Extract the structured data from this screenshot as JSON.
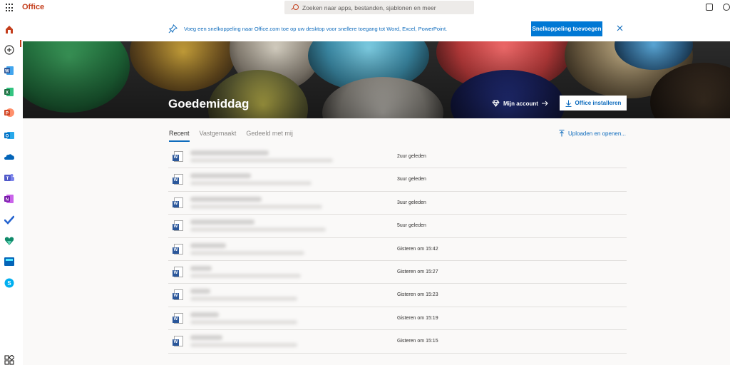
{
  "app": {
    "brand": "Office"
  },
  "search": {
    "placeholder": "Zoeken naar apps, bestanden, sjablonen en meer"
  },
  "banner": {
    "text": "Voeg een snelkoppeling naar Office.com toe op uw desktop voor snellere toegang tot Word, Excel, PowerPoint.",
    "button_label": "Snelkoppeling toevoegen"
  },
  "hero": {
    "greeting": "Goedemiddag",
    "account_label": "Mijn account",
    "install_label": "Office installeren"
  },
  "tabs": [
    {
      "label": "Recent",
      "active": true
    },
    {
      "label": "Vastgemaakt",
      "active": false
    },
    {
      "label": "Gedeeld met mij",
      "active": false
    }
  ],
  "upload_label": "Uploaden en openen...",
  "rail": {
    "icons": [
      "home-icon",
      "create-icon",
      "word-icon",
      "excel-icon",
      "powerpoint-icon",
      "outlook-icon",
      "onedrive-icon",
      "teams-icon",
      "onenote-icon",
      "todo-icon",
      "family-safety-icon",
      "sway-icon",
      "skype-icon",
      "all-apps-icon"
    ],
    "colors": {
      "home": "#c43e1c",
      "word": "#2b579a",
      "excel": "#217346",
      "powerpoint": "#d24726",
      "outlook": "#0072c6",
      "onedrive": "#0364b8",
      "teams": "#5059c9",
      "onenote": "#7719aa",
      "todo": "#2564cf",
      "family": "#0f8a6a",
      "sway": "#008272",
      "skype": "#00aff0"
    }
  },
  "files": [
    {
      "time": "2uur geleden"
    },
    {
      "time": "3uur geleden"
    },
    {
      "time": "3uur geleden"
    },
    {
      "time": "5uur geleden"
    },
    {
      "time": "Gisteren om 15:42"
    },
    {
      "time": "Gisteren om 15:27"
    },
    {
      "time": "Gisteren om 15:23"
    },
    {
      "time": "Gisteren om 15:19"
    },
    {
      "time": "Gisteren om 15:15"
    }
  ]
}
